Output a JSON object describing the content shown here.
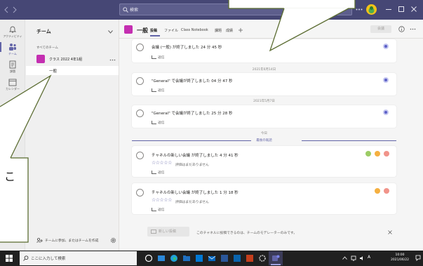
{
  "window": {
    "search_placeholder": "検索"
  },
  "rail": {
    "items": [
      {
        "label": "アクティビティ",
        "icon": "bell-icon"
      },
      {
        "label": "チーム",
        "icon": "teams-icon",
        "selected": true
      },
      {
        "label": "課題",
        "icon": "assignments-icon"
      },
      {
        "label": "カレンダー",
        "icon": "calendar-icon"
      }
    ]
  },
  "teams_pane": {
    "title": "チーム",
    "section_label": "すべてのチーム",
    "team": {
      "name": "クラス 2022 4年1組"
    },
    "channels": [
      {
        "name": "一般",
        "selected": true
      }
    ],
    "join_label": "チームに参加、またはチームを作成"
  },
  "channel_header": {
    "name": "一般",
    "tabs": [
      {
        "label": "投稿",
        "active": true
      },
      {
        "label": "ファイル"
      },
      {
        "label": "Class Notebook"
      },
      {
        "label": "課題"
      },
      {
        "label": "成績"
      }
    ],
    "meet_label": "会議"
  },
  "feed": {
    "posts": [
      {
        "text": "会議 (一般) が終了しました 24 分 45 秒",
        "reply": "返信"
      },
      {
        "text": "\"General\" で会議が終了しました 04 分 47 秒",
        "reply": "返信"
      },
      {
        "text": "\"General\" で会議が終了しました 25 分 28 秒",
        "reply": "返信"
      },
      {
        "text": "チャネルの新しい会議 が終了しました 4 分 41 秒",
        "rating": "☆☆☆☆☆",
        "rating_note": "評価はまだありません",
        "reply": "返信"
      },
      {
        "text": "チャネルの新しい会議 が終了しました 1 分 18 秒",
        "rating": "☆☆☆☆☆",
        "rating_note": "評価はまだありません",
        "reply": "返信"
      }
    ],
    "date_separators": [
      "2021年6月14日",
      "2021年5月7日"
    ],
    "today_label": "今日",
    "last_read_label": "最後の既読"
  },
  "compose": {
    "new_post_label": "新しい投稿",
    "notice": "このチャネルに投稿できるのは、チームのモデレーターのみです。"
  },
  "taskbar": {
    "search_placeholder": "ここに入力して検索",
    "ime_label": "A",
    "time": "10:00",
    "date": "2021/06/22"
  },
  "callouts": {
    "left_text": "こ"
  },
  "colors": {
    "titlebar": "#464775",
    "accent": "#6264a7",
    "team_tile": "#c42fb1",
    "callout_border": "#5d6e34",
    "taskbar": "#202020"
  }
}
